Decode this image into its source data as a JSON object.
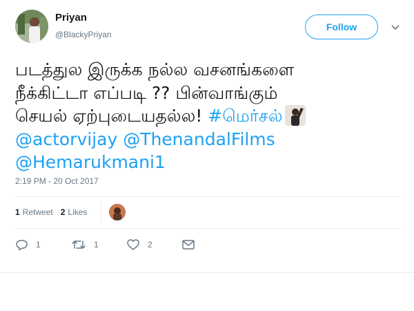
{
  "author": {
    "name": "Priyan",
    "handle": "@BlackyPriyan"
  },
  "follow_label": "Follow",
  "tweet": {
    "lines": [
      "படத்துல இருக்க நல்ல வசனங்களை",
      "நீக்கிட்டா எப்படி ?? பின்வாங்கும்",
      "செயல் ஏற்புடையதல்ல! "
    ],
    "hashtag": "#மெர்சல்",
    "mentions_line1": "@actorvijay @ThenandalFilms",
    "mentions_line2": "@Hemarukmani1",
    "timestamp": "2:19 PM - 20 Oct 2017"
  },
  "stats": {
    "retweet_count": "1",
    "retweet_label": "Retweet",
    "like_count": "2",
    "like_label": "Likes"
  },
  "actions": {
    "reply_count": "1",
    "retweet_count": "1",
    "like_count": "2"
  },
  "colors": {
    "accent": "#1da1f2",
    "muted": "#657786",
    "text": "#14171a",
    "border": "#e6ecf0"
  },
  "icons": [
    "chevron-down-icon",
    "reply-icon",
    "retweet-icon",
    "heart-icon",
    "envelope-icon"
  ]
}
